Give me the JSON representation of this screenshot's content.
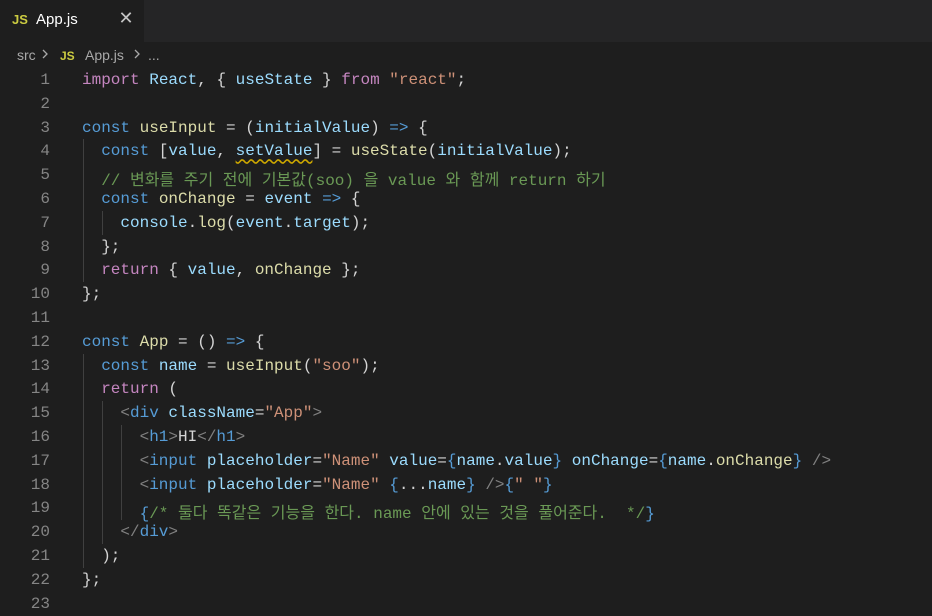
{
  "tab": {
    "icon_label": "JS",
    "title": "App.js",
    "close_glyph": "✕"
  },
  "breadcrumb": {
    "folder": "src",
    "icon_label": "JS",
    "file": "App.js",
    "more": "..."
  },
  "editor": {
    "language": "javascript",
    "lines": [
      {
        "n": "1",
        "indent": 0,
        "tokens": [
          [
            "kw2",
            "import"
          ],
          [
            "p",
            " "
          ],
          [
            "v",
            "React"
          ],
          [
            "p",
            ", { "
          ],
          [
            "v",
            "useState"
          ],
          [
            "p",
            " } "
          ],
          [
            "kw2",
            "from"
          ],
          [
            "p",
            " "
          ],
          [
            "s",
            "\"react\""
          ],
          [
            "p",
            ";"
          ]
        ]
      },
      {
        "n": "2",
        "indent": 0,
        "tokens": []
      },
      {
        "n": "3",
        "indent": 0,
        "tokens": [
          [
            "kw",
            "const"
          ],
          [
            "p",
            " "
          ],
          [
            "f",
            "useInput"
          ],
          [
            "p",
            " = ("
          ],
          [
            "v",
            "initialValue"
          ],
          [
            "p",
            ") "
          ],
          [
            "kw",
            "=>"
          ],
          [
            "p",
            " {"
          ]
        ]
      },
      {
        "n": "4",
        "indent": 1,
        "tokens": [
          [
            "kw",
            "const"
          ],
          [
            "p",
            " ["
          ],
          [
            "v",
            "value"
          ],
          [
            "p",
            ", "
          ],
          [
            "vsq",
            "setValue"
          ],
          [
            "p",
            "] = "
          ],
          [
            "f",
            "useState"
          ],
          [
            "p",
            "("
          ],
          [
            "v",
            "initialValue"
          ],
          [
            "p",
            ");"
          ]
        ]
      },
      {
        "n": "5",
        "indent": 1,
        "tokens": [
          [
            "c",
            "// 변화를 주기 전에 기본값(soo) 을 value 와 함께 return 하기"
          ]
        ]
      },
      {
        "n": "6",
        "indent": 1,
        "tokens": [
          [
            "kw",
            "const"
          ],
          [
            "p",
            " "
          ],
          [
            "f",
            "onChange"
          ],
          [
            "p",
            " = "
          ],
          [
            "v",
            "event"
          ],
          [
            "p",
            " "
          ],
          [
            "kw",
            "=>"
          ],
          [
            "p",
            " {"
          ]
        ]
      },
      {
        "n": "7",
        "indent": 2,
        "tokens": [
          [
            "v",
            "console"
          ],
          [
            "p",
            "."
          ],
          [
            "f",
            "log"
          ],
          [
            "p",
            "("
          ],
          [
            "v",
            "event"
          ],
          [
            "p",
            "."
          ],
          [
            "v",
            "target"
          ],
          [
            "p",
            ");"
          ]
        ]
      },
      {
        "n": "8",
        "indent": 1,
        "tokens": [
          [
            "p",
            "};"
          ]
        ]
      },
      {
        "n": "9",
        "indent": 1,
        "tokens": [
          [
            "kw2",
            "return"
          ],
          [
            "p",
            " { "
          ],
          [
            "v",
            "value"
          ],
          [
            "p",
            ", "
          ],
          [
            "f",
            "onChange"
          ],
          [
            "p",
            " };"
          ]
        ]
      },
      {
        "n": "10",
        "indent": 0,
        "tokens": [
          [
            "p",
            "};"
          ]
        ]
      },
      {
        "n": "11",
        "indent": 0,
        "tokens": []
      },
      {
        "n": "12",
        "indent": 0,
        "tokens": [
          [
            "kw",
            "const"
          ],
          [
            "p",
            " "
          ],
          [
            "f",
            "App"
          ],
          [
            "p",
            " = () "
          ],
          [
            "kw",
            "=>"
          ],
          [
            "p",
            " {"
          ]
        ]
      },
      {
        "n": "13",
        "indent": 1,
        "tokens": [
          [
            "kw",
            "const"
          ],
          [
            "p",
            " "
          ],
          [
            "v",
            "name"
          ],
          [
            "p",
            " = "
          ],
          [
            "f",
            "useInput"
          ],
          [
            "p",
            "("
          ],
          [
            "s",
            "\"soo\""
          ],
          [
            "p",
            ");"
          ]
        ]
      },
      {
        "n": "14",
        "indent": 1,
        "tokens": [
          [
            "kw2",
            "return"
          ],
          [
            "p",
            " ("
          ]
        ]
      },
      {
        "n": "15",
        "indent": 2,
        "tokens": [
          [
            "b",
            "<"
          ],
          [
            "t",
            "div"
          ],
          [
            "p",
            " "
          ],
          [
            "a",
            "className"
          ],
          [
            "p",
            "="
          ],
          [
            "s",
            "\"App\""
          ],
          [
            "b",
            ">"
          ]
        ]
      },
      {
        "n": "16",
        "indent": 3,
        "tokens": [
          [
            "b",
            "<"
          ],
          [
            "t",
            "h1"
          ],
          [
            "b",
            ">"
          ],
          [
            "p",
            "HI"
          ],
          [
            "b",
            "</"
          ],
          [
            "t",
            "h1"
          ],
          [
            "b",
            ">"
          ]
        ]
      },
      {
        "n": "17",
        "indent": 3,
        "tokens": [
          [
            "b",
            "<"
          ],
          [
            "t",
            "input"
          ],
          [
            "p",
            " "
          ],
          [
            "a",
            "placeholder"
          ],
          [
            "p",
            "="
          ],
          [
            "s",
            "\"Name\""
          ],
          [
            "p",
            " "
          ],
          [
            "a",
            "value"
          ],
          [
            "p",
            "="
          ],
          [
            "kw",
            "{"
          ],
          [
            "v",
            "name"
          ],
          [
            "p",
            "."
          ],
          [
            "v",
            "value"
          ],
          [
            "kw",
            "}"
          ],
          [
            "p",
            " "
          ],
          [
            "a",
            "onChange"
          ],
          [
            "p",
            "="
          ],
          [
            "kw",
            "{"
          ],
          [
            "v",
            "name"
          ],
          [
            "p",
            "."
          ],
          [
            "f",
            "onChange"
          ],
          [
            "kw",
            "}"
          ],
          [
            "p",
            " "
          ],
          [
            "b",
            "/>"
          ]
        ]
      },
      {
        "n": "18",
        "indent": 3,
        "tokens": [
          [
            "b",
            "<"
          ],
          [
            "t",
            "input"
          ],
          [
            "p",
            " "
          ],
          [
            "a",
            "placeholder"
          ],
          [
            "p",
            "="
          ],
          [
            "s",
            "\"Name\""
          ],
          [
            "p",
            " "
          ],
          [
            "kw",
            "{"
          ],
          [
            "p",
            "..."
          ],
          [
            "v",
            "name"
          ],
          [
            "kw",
            "}"
          ],
          [
            "p",
            " "
          ],
          [
            "b",
            "/>"
          ],
          [
            "kw",
            "{"
          ],
          [
            "s",
            "\" \""
          ],
          [
            "kw",
            "}"
          ]
        ]
      },
      {
        "n": "19",
        "indent": 3,
        "tokens": [
          [
            "kw",
            "{"
          ],
          [
            "c",
            "/* 둘다 똑같은 기능을 한다. name 안에 있는 것을 풀어준다.  */"
          ],
          [
            "kw",
            "}"
          ]
        ]
      },
      {
        "n": "20",
        "indent": 2,
        "tokens": [
          [
            "b",
            "</"
          ],
          [
            "t",
            "div"
          ],
          [
            "b",
            ">"
          ]
        ]
      },
      {
        "n": "21",
        "indent": 1,
        "tokens": [
          [
            "p",
            ");"
          ]
        ]
      },
      {
        "n": "22",
        "indent": 0,
        "tokens": [
          [
            "p",
            "};"
          ]
        ]
      },
      {
        "n": "23",
        "indent": 0,
        "tokens": []
      }
    ]
  },
  "colors": {
    "background": "#1e1e1e",
    "tabbar": "#252526",
    "keyword": "#569cd6",
    "control": "#c586c0",
    "function": "#dcdcaa",
    "variable": "#9cdcfe",
    "string": "#ce9178",
    "comment": "#6a9955",
    "js_icon": "#cbcb41"
  }
}
